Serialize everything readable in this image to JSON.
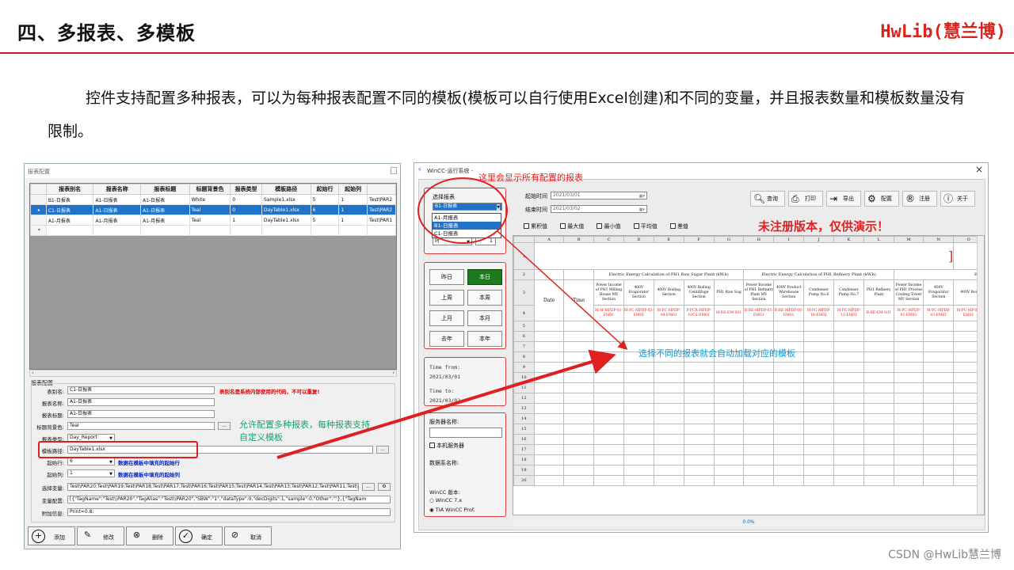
{
  "slide": {
    "title": "四、多报表、多模板",
    "brand": "HwLib(慧兰博)",
    "paragraph": "控件支持配置多种报表，可以为每种报表配置不同的模板(模板可以自行使用Excel创建)和不同的变量，并且报表数量和模板数量没有限制。",
    "watermark": "CSDN @HwLib慧兰博"
  },
  "dialog": {
    "title": "报表配置",
    "columns": [
      "报表别名",
      "报表名称",
      "报表标题",
      "标题背景色",
      "报表类型",
      "模板路径",
      "起始行",
      "起始列"
    ],
    "rows": [
      {
        "ind": "",
        "cells": [
          "B1-日报表",
          "A1-日报表",
          "A1-日报表",
          "White",
          "0",
          "Sample1.xlsx",
          "5",
          "1",
          "Test\\PAR2"
        ]
      },
      {
        "ind": "▸",
        "cells": [
          "C1-日报表",
          "A1-日报表",
          "A1-日报表",
          "Teal",
          "0",
          "DayTable1.xlsx",
          "6",
          "1",
          "Test\\PAR2"
        ],
        "selected": true
      },
      {
        "ind": "",
        "cells": [
          "A1-月报表",
          "A1-月报表",
          "A1-月报表",
          "Teal",
          "1",
          "DayTable1.xlsx",
          "5",
          "1",
          "Test\\PAR1"
        ]
      },
      {
        "ind": "*",
        "cells": [
          "",
          "",
          "",
          "",
          "",
          "",
          "",
          "",
          ""
        ]
      }
    ],
    "group_label": "报表配置",
    "fields": {
      "alias_label": "表别名:",
      "alias_value": "C1-日报表",
      "alias_note": "表别名是系统内部使用的代码，不可以重复!",
      "name_label": "报表名称:",
      "name_value": "A1-日报表",
      "title_label": "报表标题:",
      "title_value": "A1-日报表",
      "bg_label": "标题背景色:",
      "bg_value": "Teal",
      "type_label": "报表类型:",
      "type_value": "Day_Report",
      "path_label": "模板路径:",
      "path_value": "DayTable1.xlsx",
      "row_label": "起始行:",
      "row_value": "6",
      "row_note": "数据在模板中填充的起始行",
      "col_label": "起始列:",
      "col_value": "1",
      "col_note": "数据在模板中填充的起始列",
      "var_label": "选择变量:",
      "var_value": "Test\\PAR20;Test\\PAR19;Test\\PAR18;Test\\PAR17;Test\\PAR16;Test\\PAR15;Test\\PAR14;Test\\PAR13;Test\\PAR12;Test\\PAR11;Test\\PAR1",
      "cfg_label": "变量配置:",
      "cfg_value": "[{\"TagName\":\"Test\\\\PAR20\",\"TagAlias\":\"Test\\\\PAR20\",\"SBW\":\"1\",\"dataType\":0,\"decDigits\":1,\"sample\":0,\"Other\":\"\"},{\"TagNam",
      "extra_label": "附加信息:",
      "extra_value": "Print=0.8;",
      "dots": "..."
    },
    "buttons": [
      {
        "icon": "+",
        "label": "添加"
      },
      {
        "icon": "✎",
        "label": "修改"
      },
      {
        "icon": "⊗",
        "label": "删除"
      },
      {
        "icon": "✓",
        "label": "确定"
      },
      {
        "icon": "⊘",
        "label": "取消"
      }
    ]
  },
  "wincc": {
    "title": "WinCC-运行系统 -",
    "select_label": "选择报表",
    "select_value": "B1-日报表",
    "options": [
      "A1-月报表",
      "B1-日报表",
      "C1-日报表"
    ],
    "unit_value": "时",
    "unit_num": "1",
    "start_label": "起始时间",
    "start_value": "2021/03/01",
    "end_label": "结束时间",
    "end_value": "2021/03/02",
    "checks": [
      "累积值",
      "最大值",
      "最小值",
      "平均值",
      "差值"
    ],
    "tools": [
      "查询",
      "打印",
      "导出",
      "配置",
      "注册",
      "关于"
    ],
    "unregistered": "未注册版本，仅供演示！",
    "periods": [
      "昨日",
      "本日",
      "上周",
      "本周",
      "上月",
      "本月",
      "去年",
      "本年"
    ],
    "time_from_label": "Time from:",
    "time_from": "2021/03/01",
    "time_to_label": "Time to:",
    "time_to": "2021/03/02",
    "server_label": "服务器名称:",
    "local_server": "本机服务器",
    "db_label": "数据系名称:",
    "version_label": "WinCC 版本:",
    "v1": "WinCC 7.x",
    "v2": "TIA WinCC Prof.",
    "status": "0.0%",
    "sheet": {
      "col_letters": [
        "A",
        "B",
        "C",
        "D",
        "E",
        "F",
        "G",
        "H",
        "I",
        "J",
        "K",
        "L",
        "M",
        "N",
        "O"
      ],
      "group1": "Electric Energy Calculation of PH1 Raw Sugar Plant (kW.h)",
      "group2": "Electric Energy Calculation of PH1 Refinery Plant (kW.h)",
      "group3": "Elec",
      "title_mark": "]",
      "date": "Date",
      "time": "Time",
      "heads": [
        "Power Income of PH1 Milling House MV Section",
        "400V Evaporator Section",
        "400V Boiling Section",
        "400V Boiling Centrifuge Section",
        "PH1 Raw Sug",
        "Power Income of PH1 Refinery Plant MV Section",
        "400V Product Warehouse Section",
        "Condenser Pump No.6",
        "Condenser Pump No.7",
        "PH1 Refinery Plant",
        "Power Income of PH1 Process Cooling Tower MV Section",
        "400V Evaporator Section",
        "400V Boi"
      ],
      "tags": [
        "M-M-MPDP-01-EM01",
        "M-PC-MPDP-03-EM01",
        "M-PC-MPDP-04-EM01",
        "P-PCR-MPDP-10CS-EM01",
        "M-RS-EM-S01",
        "R-RE-MPDP-01-EM01",
        "R-RE-MPDP-06-EM01",
        "M-PC-MPDP-10-EM01",
        "M-PC-MPDP-11-EM01",
        "R-RE-EM-S01",
        "M-PC-MPDP-01-EM01",
        "M-PC-MPDP-03-EM01",
        "M-PC-MP-04-EM01"
      ],
      "row_numbers": [
        "1",
        "2",
        "3",
        "4",
        "5",
        "6",
        "7",
        "8",
        "9",
        "10",
        "11",
        "12",
        "13",
        "14",
        "15",
        "16",
        "17",
        "18",
        "19",
        "20"
      ]
    }
  },
  "callouts": {
    "top": "这里会显示所有配置的报表",
    "middle": "选择不同的报表就会自动加载对应的模板",
    "left1": "允许配置多种报表，每种报表支持",
    "left2": "自定义模板"
  },
  "colors": {
    "red": "#e02020",
    "blue": "#0a9ad8",
    "selection": "#1f73c9",
    "brand": "#d8241d"
  }
}
